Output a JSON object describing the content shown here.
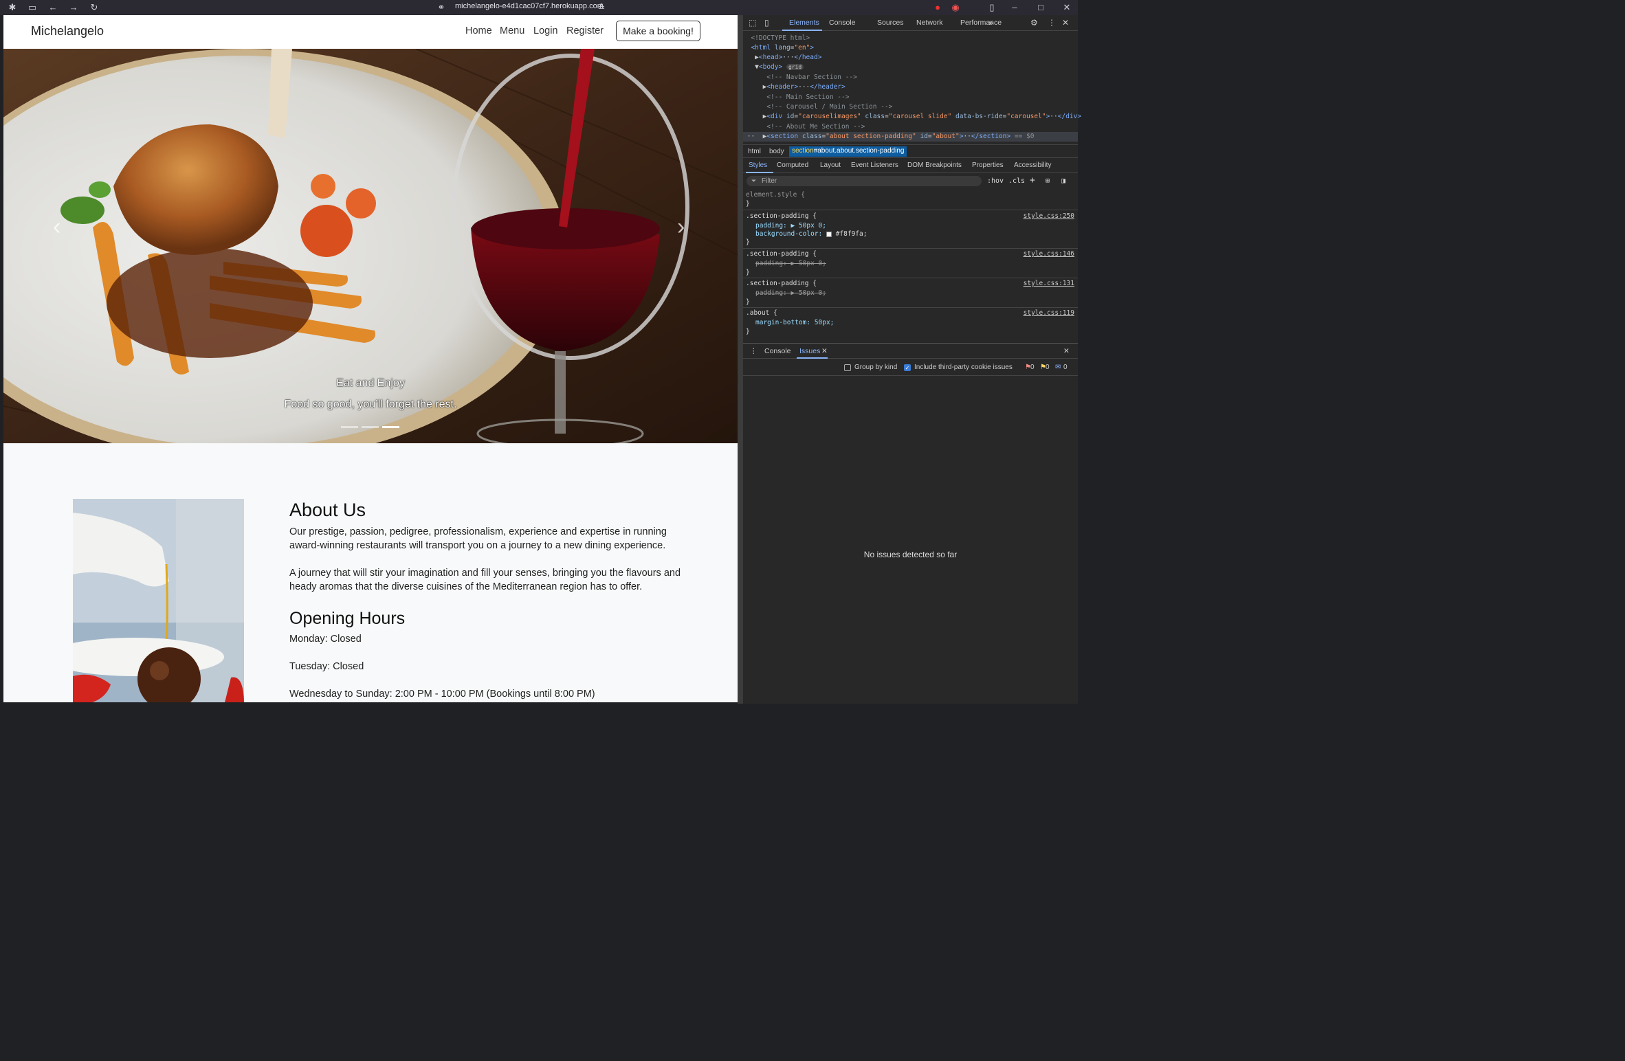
{
  "browser": {
    "url": "michelangelo-e4d1cac07cf7.herokuapp.com"
  },
  "site": {
    "brand": "Michelangelo",
    "nav": [
      "Home",
      "Menu",
      "Login",
      "Register"
    ],
    "booking_button": "Make a booking!",
    "carousel": {
      "caption_title": "Eat and Enjoy",
      "caption_text": "Food so good, you’ll forget the rest.",
      "prev_icon": "chevron-left-icon",
      "next_icon": "chevron-right-icon",
      "indicator_count": 3,
      "active_indicator": 3
    },
    "about": {
      "title": "About Us",
      "p1": "Our prestige, passion, pedigree, professionalism, experience and expertise in running award-winning restaurants will transport you on a journey to a new dining experience.",
      "p2": "A journey that will stir your imagination and fill your senses, bringing you the flavours and heady aromas that the diverse cuisines of the Mediterranean region has to offer.",
      "hours_title": "Opening Hours",
      "hours": [
        "Monday: Closed",
        "Tuesday: Closed",
        "Wednesday to Sunday: 2:00 PM - 10:00 PM (Bookings until 8:00 PM)"
      ]
    }
  },
  "devtools": {
    "tabs": [
      "Elements",
      "Console",
      "Sources",
      "Network",
      "Performance"
    ],
    "active_tab": "Elements",
    "breadcrumbs": [
      "html",
      "body"
    ],
    "breadcrumb_selected_prefix": "section",
    "breadcrumb_selected_rest": "#about.about.section-padding",
    "subtabs": [
      "Styles",
      "Computed",
      "Layout",
      "Event Listeners",
      "DOM Breakpoints",
      "Properties",
      "Accessibility"
    ],
    "filter_placeholder": "Filter",
    "filter_tools": [
      ":hov",
      ".cls"
    ],
    "rules": {
      "element_style": "element.style {",
      "close": "}",
      "r1_selector": ".section-padding {",
      "r1_source": "style.css:250",
      "r1_padding": "padding: ▶ 50px 0;",
      "r1_bg_name": "background-color:",
      "r1_bg_val": "#f8f9fa;",
      "r2_selector": ".section-padding {",
      "r2_source": "style.css:146",
      "r2_padding": "padding: ▶ 50px 0;",
      "r3_selector": ".section-padding {",
      "r3_source": "style.css:131",
      "r3_padding": "padding: ▶ 50px 0;",
      "r4_selector": ".about {",
      "r4_source": "style.css:119",
      "r4_margin": "margin-bottom: 50px;"
    },
    "drawer": {
      "tabs": [
        "Console",
        "Issues"
      ],
      "active_tab": "Issues",
      "group_by_kind": "Group by kind",
      "third_party": "Include third-party cookie issues",
      "counts": [
        "0",
        "0",
        "0"
      ],
      "empty_message": "No issues detected so far"
    }
  }
}
